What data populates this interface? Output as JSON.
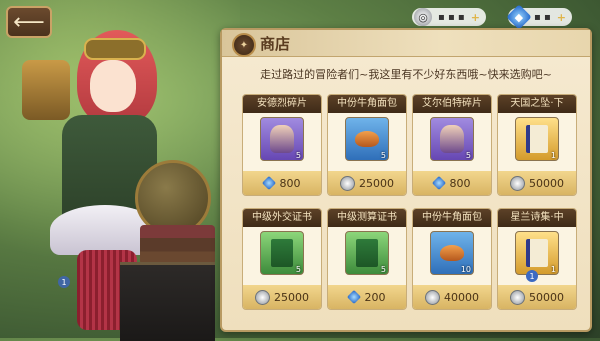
{
  "topbar": {
    "back_icon": "back-arrow-icon",
    "currencies": [
      {
        "icon": "silver-coin-icon",
        "value": "▪ ▪ ▪",
        "add_label": "+"
      },
      {
        "icon": "blue-gem-icon",
        "value": "▪ ▪",
        "add_label": "+"
      }
    ]
  },
  "shop": {
    "title": "商店",
    "greeting": "走过路过的冒险者们~我这里有不少好东西哦~快来选购吧~",
    "items": [
      {
        "name": "安德烈碎片",
        "qty": "5",
        "price": "800",
        "currency": "gem",
        "icon": "portrait-shard-icon",
        "tier": "purple"
      },
      {
        "name": "中份牛角面包",
        "qty": "5",
        "price": "25000",
        "currency": "coin",
        "icon": "croissant-icon",
        "tier": "blue"
      },
      {
        "name": "艾尔伯特碎片",
        "qty": "5",
        "price": "800",
        "currency": "gem",
        "icon": "portrait-shard-icon",
        "tier": "purple"
      },
      {
        "name": "天国之坠·下",
        "qty": "1",
        "price": "50000",
        "currency": "coin",
        "icon": "book-icon",
        "tier": "gold"
      },
      {
        "name": "中级外交证书",
        "qty": "5",
        "price": "25000",
        "currency": "coin",
        "icon": "certificate-icon",
        "tier": "green"
      },
      {
        "name": "中级测算证书",
        "qty": "5",
        "price": "200",
        "currency": "gem",
        "icon": "certificate-icon",
        "tier": "green"
      },
      {
        "name": "中份牛角面包",
        "qty": "10",
        "price": "40000",
        "currency": "coin",
        "icon": "croissant-icon",
        "tier": "blue"
      },
      {
        "name": "星兰诗集·中",
        "qty": "1",
        "price": "50000",
        "currency": "coin",
        "icon": "book-icon",
        "tier": "gold"
      }
    ]
  },
  "badges": {
    "panel_badge": "1",
    "char_badge": "1"
  }
}
